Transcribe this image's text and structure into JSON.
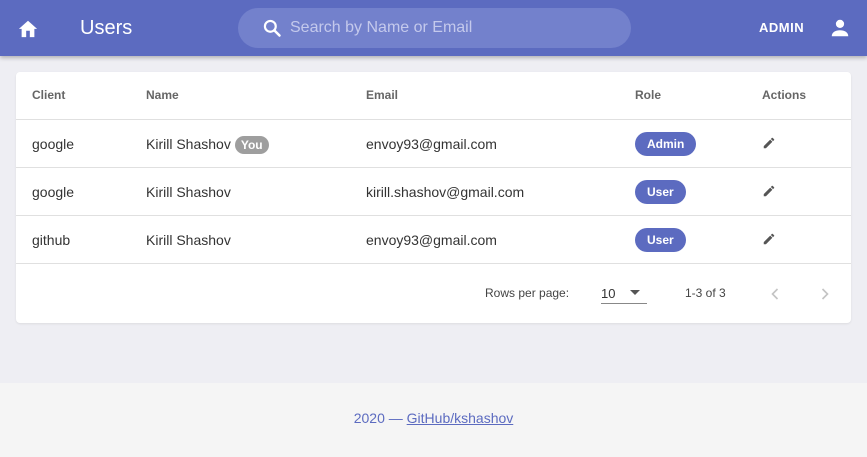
{
  "appbar": {
    "title": "Users",
    "search_placeholder": "Search by Name or Email",
    "search_value": "",
    "admin_label": "ADMIN"
  },
  "table": {
    "columns": [
      "Client",
      "Name",
      "Email",
      "Role",
      "Actions"
    ],
    "rows": [
      {
        "client": "google",
        "name": "Kirill Shashov",
        "you_badge": "You",
        "email": "envoy93@gmail.com",
        "role": "Admin"
      },
      {
        "client": "google",
        "name": "Kirill Shashov",
        "you_badge": "",
        "email": "kirill.shashov@gmail.com",
        "role": "User"
      },
      {
        "client": "github",
        "name": "Kirill Shashov",
        "you_badge": "",
        "email": "envoy93@gmail.com",
        "role": "User"
      }
    ]
  },
  "pagination": {
    "rows_per_page_label": "Rows per page:",
    "rows_per_page_value": "10",
    "range_label": "1-3 of 3"
  },
  "footer": {
    "prefix": "2020 — ",
    "link_label": "GitHub/kshashov"
  },
  "colors": {
    "primary": "#5c6bc0",
    "chip_grey": "#9e9e9e",
    "background": "#eeeef3"
  },
  "icons": {
    "home": "home-icon",
    "search": "search-icon",
    "account": "account-icon",
    "edit": "pencil-icon",
    "prev": "chevron-left-icon",
    "next": "chevron-right-icon",
    "dropdown": "caret-down-icon"
  }
}
